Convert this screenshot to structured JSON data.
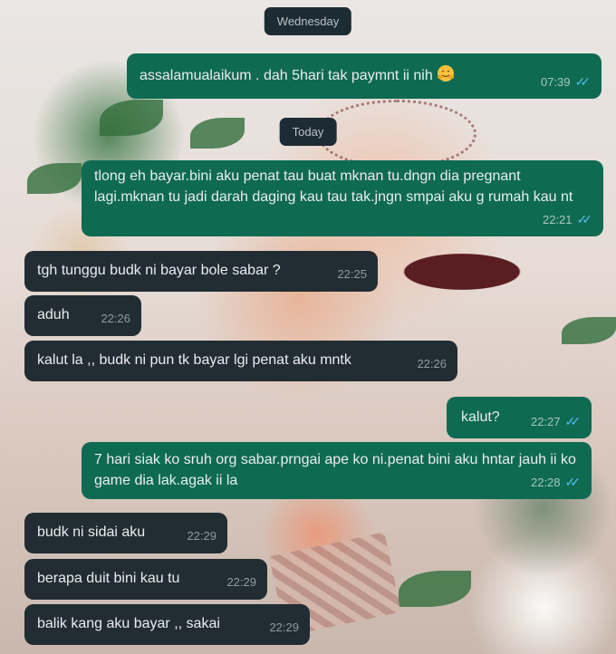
{
  "date_separators": {
    "first": "Wednesday",
    "second": "Today"
  },
  "messages": [
    {
      "id": "m1",
      "direction": "outgoing",
      "text": "assalamualaikum . dah 5hari tak paymnt ii nih",
      "emoji": "smiling-face-with-open-hands-icon",
      "time": "07:39",
      "status": "read"
    },
    {
      "id": "m2",
      "direction": "outgoing",
      "text": "tlong eh bayar.bini aku penat tau buat mknan tu.dngn dia pregnant lagi.mknan tu jadi darah daging kau tau tak.jngn smpai aku g rumah kau nt",
      "time": "22:21",
      "status": "read"
    },
    {
      "id": "m3",
      "direction": "incoming",
      "text": "tgh tunggu budk ni bayar bole sabar ?",
      "time": "22:25"
    },
    {
      "id": "m4",
      "direction": "incoming",
      "text": "aduh",
      "time": "22:26"
    },
    {
      "id": "m5",
      "direction": "incoming",
      "text": "kalut la ,, budk ni pun tk bayar lgi penat aku mntk",
      "time": "22:26"
    },
    {
      "id": "m6",
      "direction": "outgoing",
      "text": "kalut?",
      "time": "22:27",
      "status": "read"
    },
    {
      "id": "m7",
      "direction": "outgoing",
      "text": "7 hari siak ko sruh org sabar.prngai ape ko ni.penat bini aku hntar jauh ii ko game dia lak.agak ii la",
      "time": "22:28",
      "status": "read"
    },
    {
      "id": "m8",
      "direction": "incoming",
      "text": "budk ni sidai aku",
      "time": "22:29"
    },
    {
      "id": "m9",
      "direction": "incoming",
      "text": "berapa duit bini kau tu",
      "time": "22:29"
    },
    {
      "id": "m10",
      "direction": "incoming",
      "text": "balik kang aku bayar ,, sakai",
      "time": "22:29"
    }
  ],
  "colors": {
    "outgoing_bubble": "#0f6a52",
    "incoming_bubble": "#222d33",
    "date_pill": "#1d2b33",
    "read_tick": "#53bdeb"
  }
}
